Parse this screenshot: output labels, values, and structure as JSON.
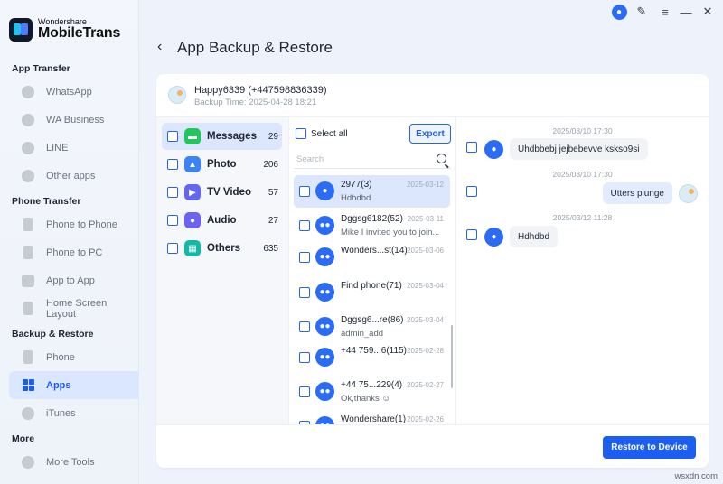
{
  "app": {
    "brand_small": "Wondershare",
    "brand_big": "MobileTrans"
  },
  "sidebar": {
    "sections": [
      {
        "title": "App Transfer",
        "items": [
          {
            "label": "WhatsApp",
            "icon": "whatsapp-icon"
          },
          {
            "label": "WA Business",
            "icon": "wa-business-icon"
          },
          {
            "label": "LINE",
            "icon": "line-icon"
          },
          {
            "label": "Other apps",
            "icon": "other-apps-icon"
          }
        ]
      },
      {
        "title": "Phone Transfer",
        "items": [
          {
            "label": "Phone to Phone",
            "icon": "phone-to-phone-icon"
          },
          {
            "label": "Phone to PC",
            "icon": "phone-to-pc-icon"
          },
          {
            "label": "App to App",
            "icon": "app-to-app-icon"
          },
          {
            "label": "Home Screen Layout",
            "icon": "home-screen-icon"
          }
        ]
      },
      {
        "title": "Backup & Restore",
        "items": [
          {
            "label": "Phone",
            "icon": "phone-icon"
          },
          {
            "label": "Apps",
            "icon": "apps-icon",
            "active": true
          },
          {
            "label": "iTunes",
            "icon": "itunes-icon"
          }
        ]
      },
      {
        "title": "More",
        "items": [
          {
            "label": "More Tools",
            "icon": "more-tools-icon"
          }
        ]
      }
    ]
  },
  "header": {
    "back": "‹",
    "title": "App Backup & Restore"
  },
  "backup": {
    "name": "Happy6339 (+447598836339)",
    "time": "Backup Time: 2025-04-28 18:21"
  },
  "categories": [
    {
      "label": "Messages",
      "count": "29",
      "color": "#22c55e",
      "icon": "messages-icon",
      "active": true
    },
    {
      "label": "Photo",
      "count": "206",
      "color": "#3b82f6",
      "icon": "photo-icon"
    },
    {
      "label": "TV Video",
      "count": "57",
      "color": "#6366f1",
      "icon": "tv-video-icon"
    },
    {
      "label": "Audio",
      "count": "27",
      "color": "#6d63f2",
      "icon": "audio-icon"
    },
    {
      "label": "Others",
      "count": "635",
      "color": "#14b8a6",
      "icon": "others-icon"
    }
  ],
  "list": {
    "select_all": "Select all",
    "export": "Export",
    "search_placeholder": "Search",
    "conversations": [
      {
        "name": "2977(3)",
        "date": "2025-03-12",
        "preview": "Hdhdbd",
        "active": true
      },
      {
        "name": "Dggsg6182(52)",
        "date": "2025-03-11",
        "preview": "Mike I invited you to join..."
      },
      {
        "name": "Wonders...st(14)",
        "date": "2025-03-06",
        "preview": ""
      },
      {
        "name": "Find phone(71)",
        "date": "2025-03-04",
        "preview": ""
      },
      {
        "name": "Dggsg6...re(86)",
        "date": "2025-03-04",
        "preview": "admin_add"
      },
      {
        "name": "+44 759...6(115)",
        "date": "2025-02-28",
        "preview": ""
      },
      {
        "name": "+44 75...229(4)",
        "date": "2025-02-27",
        "preview": "Ok,thanks ☺"
      },
      {
        "name": "Wondershare(1)",
        "date": "2025-02-26",
        "preview": ""
      }
    ]
  },
  "chat": {
    "messages": [
      {
        "time": "2025/03/10 17:30",
        "text": "Uhdbbebj jejbebevve ksksо9si",
        "dir": "in"
      },
      {
        "time": "2025/03/10 17:30",
        "text": "Utters plunge",
        "dir": "out"
      },
      {
        "time": "2025/03/12 11:28",
        "text": "Hdhdbd",
        "dir": "in"
      }
    ]
  },
  "footer": {
    "restore": "Restore to Device"
  },
  "watermark": "wsxdn.com",
  "colors": {
    "accent": "#1d5ef2",
    "active_bg": "#dce7fd"
  }
}
